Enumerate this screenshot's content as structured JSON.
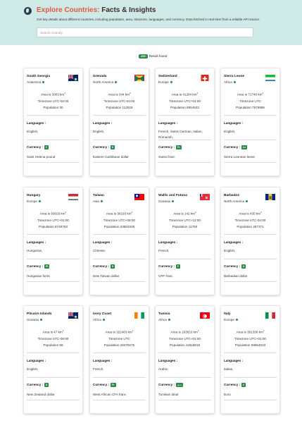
{
  "header": {
    "title_accent": "Explore Countries:",
    "title_rest": " Facts & Insights",
    "subtitle": "Get key details about different countries, including population, area, timezone, languages, and currency. Data fetched in real-time from a reliable API source.",
    "search_placeholder": "Search Country"
  },
  "results": {
    "count": "250",
    "label": "Result found"
  },
  "labels": {
    "languages": "Languages :",
    "currency": "Currency :"
  },
  "colors": {
    "header_bg": "#cfe9e6",
    "accent": "#e05b3c",
    "badge_green": "#2c8a46"
  },
  "countries": [
    {
      "name": "South Georgia",
      "region": "Antarctica",
      "area": "Area is 3903 km",
      "timezone": "Timezone UTC-02:00",
      "population": "Population 30",
      "languages": "English,",
      "currency_symbol": "£",
      "currency": "Saint Helena pound",
      "flag": "uk-blue-ensign"
    },
    {
      "name": "Grenada",
      "region": "North America",
      "area": "Area is 344 km",
      "timezone": "Timezone UTC-04:00",
      "population": "Population 112519",
      "languages": "English,",
      "currency_symbol": "$",
      "currency": "Eastern Caribbean dollar",
      "flag": "grenada"
    },
    {
      "name": "Switzerland",
      "region": "Europe",
      "area": "Area is 41284 km",
      "timezone": "Timezone UTC+01:00",
      "population": "Population 8654622",
      "languages": "French, Swiss German, Italian, Romansh,",
      "currency_symbol": "Fr.",
      "currency": "Swiss franc",
      "flag": "switzerland"
    },
    {
      "name": "Sierra Leone",
      "region": "Africa",
      "area": "Area is 71740 km",
      "timezone": "Timezone UTC",
      "population": "Population 7976985",
      "languages": "English,",
      "currency_symbol": "Le",
      "currency": "Sierra Leonean leone",
      "flag": "sierra-leone"
    },
    {
      "name": "Hungary",
      "region": "Europe",
      "area": "Area is 93028 km",
      "timezone": "Timezone UTC+01:00",
      "population": "Population 9749763",
      "languages": "Hungarian,",
      "currency_symbol": "Ft",
      "currency": "Hungarian forint",
      "flag": "hungary"
    },
    {
      "name": "Taiwan",
      "region": "Asia",
      "area": "Area is 36193 km",
      "timezone": "Timezone UTC+08:00",
      "population": "Population 23503349",
      "languages": "Chinese,",
      "currency_symbol": "$",
      "currency": "New Taiwan dollar",
      "flag": "taiwan"
    },
    {
      "name": "Wallis and Futuna",
      "region": "Oceania",
      "area": "Area is 142 km",
      "timezone": "Timezone UTC+12:00",
      "population": "Population 11750",
      "languages": "French,",
      "currency_symbol": "₣",
      "currency": "CFP franc",
      "flag": "wallis-futuna"
    },
    {
      "name": "Barbados",
      "region": "North America",
      "area": "Area is 430 km",
      "timezone": "Timezone UTC-04:00",
      "population": "Population 287371",
      "languages": "English,",
      "currency_symbol": "$",
      "currency": "Barbadian dollar",
      "flag": "barbados"
    },
    {
      "name": "Pitcairn Islands",
      "region": "Oceania",
      "area": "Area is 47 km",
      "timezone": "Timezone UTC-08:00",
      "population": "Population 56",
      "languages": "English,",
      "currency_symbol": "$",
      "currency": "New Zealand dollar",
      "flag": "uk-blue-ensign"
    },
    {
      "name": "Ivory Coast",
      "region": "Africa",
      "area": "Area is 322463 km",
      "timezone": "Timezone UTC",
      "population": "Population 26378275",
      "languages": "French,",
      "currency_symbol": "Fr",
      "currency": "West African CFA franc",
      "flag": "ivory-coast"
    },
    {
      "name": "Tunisia",
      "region": "Africa",
      "area": "Area is 163610 km",
      "timezone": "Timezone UTC+01:00",
      "population": "Population 11818618",
      "languages": "Arabic,",
      "currency_symbol": "د.ت",
      "currency": "Tunisian dinar",
      "flag": "tunisia"
    },
    {
      "name": "Italy",
      "region": "Europe",
      "area": "Area is 301336 km",
      "timezone": "Timezone UTC+01:00",
      "population": "Population 59554023",
      "languages": "Italian,",
      "currency_symbol": "€",
      "currency": "Euro",
      "flag": "italy"
    }
  ]
}
